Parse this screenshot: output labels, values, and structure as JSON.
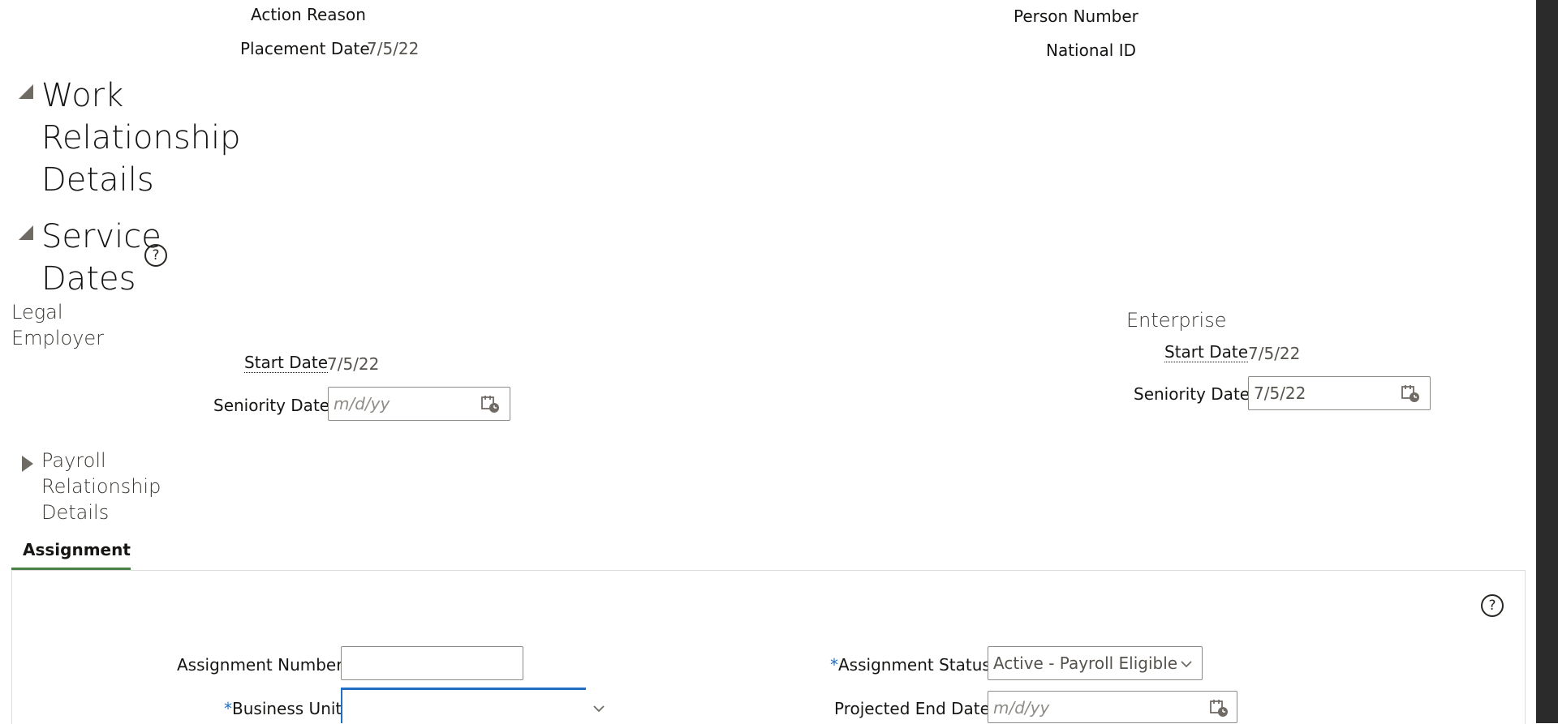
{
  "top_fields": {
    "action_reason_label": "Action Reason",
    "placement_date_label": "Placement Date",
    "placement_date_value": "7/5/22",
    "person_number_label": "Person Number",
    "national_id_label": "National ID"
  },
  "work_relationship": {
    "title_line1": "Work",
    "title_line2": "Relationship",
    "title_line3": "Details"
  },
  "service_dates": {
    "title_line1": "Service",
    "title_line2": "Dates",
    "help_glyph": "?",
    "legal_employer": {
      "heading_line1": "Legal",
      "heading_line2": "Employer",
      "start_date_label": "Start Date",
      "start_date_value": "7/5/22",
      "seniority_date_label": "Seniority Date",
      "seniority_date_placeholder": "m/d/yy"
    },
    "enterprise": {
      "heading": "Enterprise",
      "start_date_label": "Start Date",
      "start_date_value": "7/5/22",
      "seniority_date_label": "Seniority Date",
      "seniority_date_value": "7/5/22"
    }
  },
  "payroll_relationship": {
    "title_line1": "Payroll",
    "title_line2": "Relationship",
    "title_line3": "Details"
  },
  "assignment": {
    "tab_label": "Assignment",
    "help_glyph": "?",
    "assignment_number_label": "Assignment Number",
    "assignment_number_value": "",
    "required_marker": "*",
    "business_unit_label": "Business Unit",
    "business_unit_value": "",
    "assignment_status_label": "Assignment Status",
    "assignment_status_value": "Active - Payroll Eligible",
    "projected_end_date_label": "Projected End Date",
    "projected_end_date_placeholder": "m/d/yy"
  },
  "colors": {
    "tab_underline": "#4b7f46",
    "focus_border": "#1f6fc4",
    "required_asterisk": "#1f6fc4"
  },
  "icons": [
    "collapse-triangle-icon",
    "expand-triangle-icon",
    "help-icon",
    "calendar-icon",
    "chevron-down-icon"
  ]
}
